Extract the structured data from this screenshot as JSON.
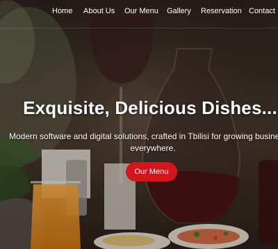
{
  "nav": {
    "items": [
      {
        "label": "Home"
      },
      {
        "label": "About Us"
      },
      {
        "label": "Our Menu"
      },
      {
        "label": "Gallery"
      },
      {
        "label": "Reservation"
      },
      {
        "label": "Contact"
      }
    ]
  },
  "hero": {
    "title": "Exquisite, Delicious Dishes...",
    "subtitle_line1": "Modern software and digital solutions, crafted in Tbilisi for growing businesses",
    "subtitle_line2": "everywhere.",
    "cta_label": "Our Menu",
    "cta_color": "#d4161c"
  }
}
